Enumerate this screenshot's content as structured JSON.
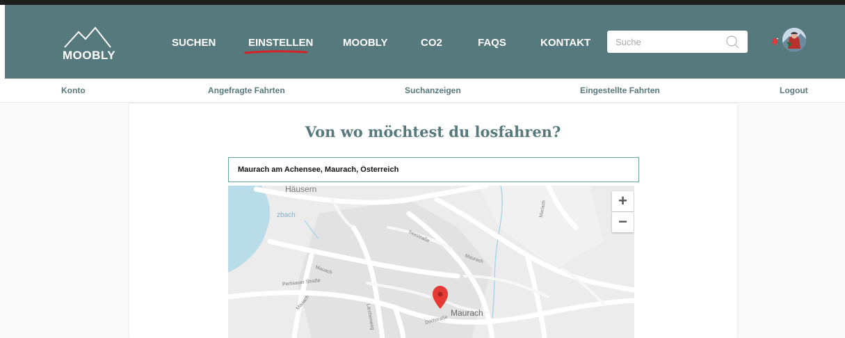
{
  "brand": {
    "logo_text": "MOOBLY"
  },
  "nav": {
    "items": [
      {
        "label": "SUCHEN"
      },
      {
        "label": "EINSTELLEN",
        "active": true
      },
      {
        "label": "MOOBLY"
      },
      {
        "label": "CO2"
      },
      {
        "label": "FAQS"
      },
      {
        "label": "KONTAKT"
      }
    ]
  },
  "search": {
    "placeholder": "Suche",
    "value": ""
  },
  "subnav": {
    "items": [
      {
        "label": "Konto"
      },
      {
        "label": "Angefragte Fahrten"
      },
      {
        "label": "Suchanzeigen"
      },
      {
        "label": "Eingestellte Fahrten"
      },
      {
        "label": "Logout"
      }
    ]
  },
  "main": {
    "title": "Von wo möchtest du losfahren?",
    "address_value": "Maurach am Achensee, Maurach, Österreich"
  },
  "map": {
    "zoom_in_label": "+",
    "zoom_out_label": "−",
    "labels": {
      "hausern": "Häusern",
      "zbach": "zbach",
      "pertisauer": "Pertisauer Straße",
      "maurach": "Maurach",
      "road1": "Mauach",
      "road2": "Dorfstraße",
      "road3": "Lärchenweg",
      "road4": "Maurach",
      "road5": "Mariach",
      "road6": "Seestraße",
      "road7": "Mauach"
    }
  },
  "colors": {
    "header_bg": "#56797d",
    "accent_underline": "#d6232a",
    "subnav_text": "#56797d",
    "water": "#b8dde8",
    "pin": "#e53935"
  }
}
